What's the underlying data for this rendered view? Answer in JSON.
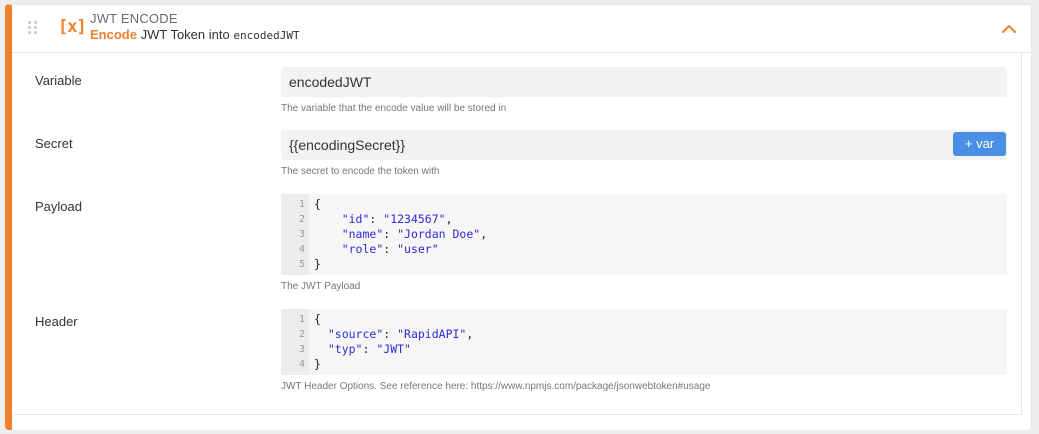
{
  "header": {
    "block_type": "JWT ENCODE",
    "icon_text": "[x]",
    "summary_verb": "Encode",
    "summary_text": "JWT Token into",
    "summary_target": "encodedJWT"
  },
  "fields": {
    "variable": {
      "label": "Variable",
      "value": "encodedJWT",
      "help": "The variable that the encode value will be stored in"
    },
    "secret": {
      "label": "Secret",
      "value": "{{encodingSecret}}",
      "help": "The secret to encode the token with",
      "var_button": "+ var"
    },
    "payload": {
      "label": "Payload",
      "help": "The JWT Payload",
      "lines": [
        {
          "n": "1",
          "text": "{"
        },
        {
          "n": "2",
          "indent": "    ",
          "key": "\"id\"",
          "value": "\"1234567\"",
          "comma": ","
        },
        {
          "n": "3",
          "indent": "    ",
          "key": "\"name\"",
          "value": "\"Jordan Doe\"",
          "comma": ","
        },
        {
          "n": "4",
          "indent": "    ",
          "key": "\"role\"",
          "value": "\"user\"",
          "comma": ""
        },
        {
          "n": "5",
          "text": "}"
        }
      ]
    },
    "header": {
      "label": "Header",
      "help": "JWT Header Options. See reference here: https://www.npmjs.com/package/jsonwebtoken#usage",
      "lines": [
        {
          "n": "1",
          "text": "{"
        },
        {
          "n": "2",
          "indent": "  ",
          "key": "\"source\"",
          "value": "\"RapidAPI\"",
          "comma": ","
        },
        {
          "n": "3",
          "indent": "  ",
          "key": "\"typ\"",
          "value": "\"JWT\"",
          "comma": ""
        },
        {
          "n": "4",
          "text": "}"
        }
      ]
    }
  },
  "colors": {
    "accent": "#f0802c",
    "button": "#4a90e2",
    "code_string": "#2b2bd4"
  },
  "icons": [
    "drag-handle-icon",
    "variable-icon",
    "chevron-up-icon"
  ]
}
